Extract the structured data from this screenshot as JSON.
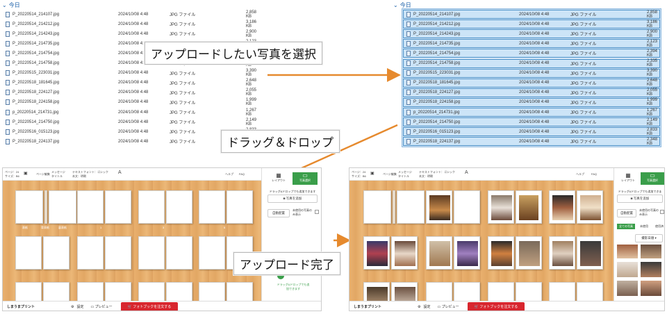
{
  "explorer_left": {
    "group": "今日",
    "files": [
      {
        "name": "P_20220514_214107.jpg",
        "date": "2024/10/08 4:48",
        "type": "JPG ファイル",
        "size": "2,858 KB"
      },
      {
        "name": "P_20220514_214212.jpg",
        "date": "2024/10/08 4:48",
        "type": "JPG ファイル",
        "size": "3,186 KB"
      },
      {
        "name": "P_20220514_214243.jpg",
        "date": "2024/10/08 4:48",
        "type": "JPG ファイル",
        "size": "2,900 KB"
      },
      {
        "name": "P_20220514_214735.jpg",
        "date": "2024/10/08 4:48",
        "type": "JPG ファイル",
        "size": "2,123 KB"
      },
      {
        "name": "P_20220514_214754.jpg",
        "date": "2024/10/08 4:48",
        "type": "JPG ファイル",
        "size": "2,394 KB"
      },
      {
        "name": "P_20220514_214758.jpg",
        "date": "2024/10/08 4:48",
        "type": "JPG ファイル",
        "size": "2,335 KB"
      },
      {
        "name": "P_20220515_223031.jpg",
        "date": "2024/10/08 4:48",
        "type": "JPG ファイル",
        "size": "3,390 KB"
      },
      {
        "name": "P_20220518_181645.jpg",
        "date": "2024/10/08 4:48",
        "type": "JPG ファイル",
        "size": "2,648 KB"
      },
      {
        "name": "P_20220518_224127.jpg",
        "date": "2024/10/08 4:48",
        "type": "JPG ファイル",
        "size": "2,055 KB"
      },
      {
        "name": "P_20220518_224158.jpg",
        "date": "2024/10/08 4:48",
        "type": "JPG ファイル",
        "size": "1,999 KB"
      },
      {
        "name": "p_20220514_214731.jpg",
        "date": "2024/10/08 4:48",
        "type": "JPG ファイル",
        "size": "1,267 KB"
      },
      {
        "name": "P_20220514_214750.jpg",
        "date": "2024/10/08 4:48",
        "type": "JPG ファイル",
        "size": "2,149 KB"
      },
      {
        "name": "P_20220516_015123.jpg",
        "date": "2024/10/08 4:48",
        "type": "JPG ファイル",
        "size": "2,833 KB"
      },
      {
        "name": "P_20220518_224137.jpg",
        "date": "2024/10/08 4:48",
        "type": "JPG ファイル",
        "size": "2,348 KB"
      }
    ]
  },
  "explorer_right": {
    "group": "今日"
  },
  "callouts": {
    "select": "アップロードしたい写真を選択",
    "drag": "ドラッグ＆ドロップ",
    "done": "アップロード完了"
  },
  "editor": {
    "toolbar": {
      "pages": "ページ：24",
      "size": "サイズ：B6",
      "save": "保存",
      "page_edit": "ページ編集",
      "layout_opt": "メッセージ",
      "title_opt": "タイトル",
      "text_setting": "テキストフォント：ゴシック",
      "text_setting2": "本文：明朝",
      "help": "ヘルプ",
      "faq": "FAQ"
    },
    "side": {
      "tab_layout": "レイアウト",
      "tab_photo": "写真選択",
      "drop_hint": "ドラッグ&ドロップでも追加できます",
      "add_photo": "写真を追加",
      "auto_place": "自動配置",
      "unused_only": "未使用の写真のみ表示",
      "drag_note": "ドラッグ&ドロップでも追加できます",
      "filter_all": "全ての写真",
      "filter_unused": "未使用",
      "filter_used": "使用済",
      "sort": "撮影日順"
    },
    "page_numbers": [
      "表紙",
      "背表紙",
      "裏表紙",
      "1",
      "2",
      "3",
      "4",
      "5",
      "6",
      "7",
      "8",
      "9",
      "10",
      "11",
      "12",
      "13",
      "14",
      "15",
      "16",
      "17",
      "18",
      "19",
      "20",
      "21",
      "22",
      "23"
    ],
    "bottom": {
      "brand": "しまうまプリント",
      "settings": "設定",
      "preview": "プレビュー",
      "order": "フォトブックを注文する"
    }
  },
  "colors": {
    "accent_green": "#3a9e4a",
    "order_red": "#d8262e",
    "select_blue": "#cce4f7",
    "arrow": "#e68a2e"
  }
}
